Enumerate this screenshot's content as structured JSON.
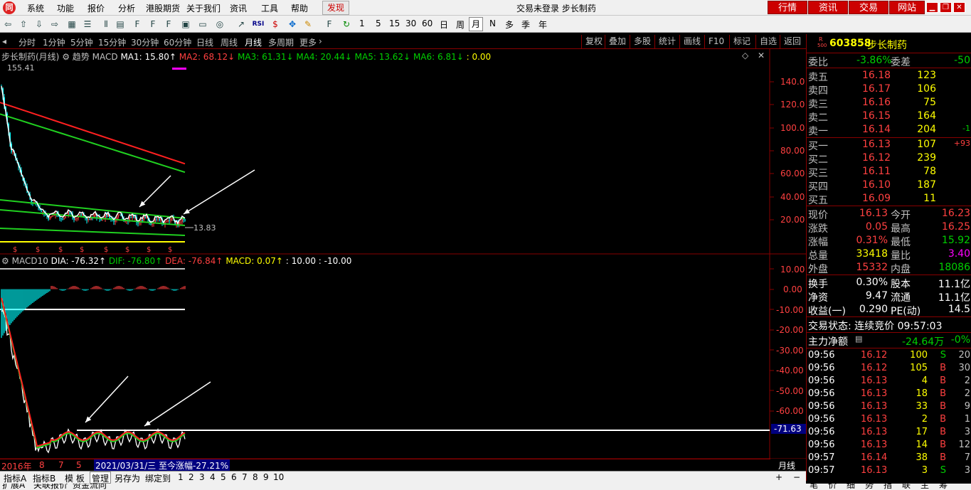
{
  "menubar": {
    "logo": "同",
    "items": [
      "系统",
      "功能",
      "报价",
      "分析",
      "港股期货",
      "关于我们",
      "资讯",
      "工具",
      "帮助"
    ],
    "active_item": "发现",
    "title": "交易未登录 步长制药",
    "right_tabs": [
      "行情",
      "资讯",
      "交易",
      "网站"
    ],
    "win_buttons": [
      "▁",
      "❐",
      "✕"
    ]
  },
  "toolbar": {
    "periods": [
      "1",
      "5",
      "15",
      "30",
      "60",
      "日",
      "周",
      "月",
      "N",
      "多",
      "季",
      "年"
    ],
    "selected_period": "月"
  },
  "periodbar": {
    "items": [
      "分时",
      "1分钟",
      "5分钟",
      "15分钟",
      "30分钟",
      "60分钟",
      "日线",
      "周线",
      "月线",
      "多周期",
      "更多"
    ],
    "selected": "月线",
    "more_arrow": "›",
    "right_items": [
      "复权",
      "叠加",
      "多股",
      "统计",
      "画线",
      "F10",
      "标记",
      "自选",
      "返回"
    ]
  },
  "main_legend": {
    "name": "步长制药(月线)",
    "mode": "趋势",
    "indicator": "MACD",
    "ma1": "MA1: 15.80↑",
    "ma2": "MA2: 68.12↓",
    "ma3": "MA3: 61.31↓",
    "ma4": "MA4: 20.44↓",
    "ma5": "MA5: 13.62↓",
    "ma6": "MA6: 6.81↓",
    "extra": ": 0.00",
    "high_label": "155.41",
    "last_label": "13.83"
  },
  "macd_legend": {
    "name": "MACD10",
    "dia": "DIA: -76.32↑",
    "dif": "DIF: -76.80↑",
    "dea": "DEA: -76.84↑",
    "macd": "MACD: 0.07↑",
    "p1": ": 10.00",
    "p2": ": -10.00"
  },
  "price_axis": [
    "140.0",
    "120.0",
    "100.0",
    "80.00",
    "60.00",
    "40.00",
    "20.00"
  ],
  "macd_axis": [
    "10.00",
    "0.00",
    "-10.00",
    "-20.00",
    "-30.00",
    "-40.00",
    "-50.00",
    "-60.00"
  ],
  "macd_highlight": "-71.63",
  "datebar": {
    "labels": [
      "2016年",
      "8",
      "7",
      "5"
    ],
    "info": "2021/03/31/三 至今涨幅-27.21%"
  },
  "period_label": "月线",
  "bottombar": {
    "items": [
      "指标A",
      "指标B",
      "模 板",
      "管理",
      "另存为",
      "绑定到",
      "1",
      "2",
      "3",
      "4",
      "5",
      "6",
      "7",
      "8",
      "9",
      "10"
    ],
    "selected": "管理"
  },
  "statusbar": {
    "items": [
      "扩展A",
      "关联报价",
      "资金流向"
    ],
    "right": [
      "笔",
      "价",
      "细",
      "势",
      "指",
      "联",
      "主",
      "筹"
    ]
  },
  "quote": {
    "badge_top": "R",
    "badge_bottom": "500",
    "code": "603858",
    "name": "步长制药",
    "weibi_label": "委比",
    "weibi": "-3.86%",
    "weicha_label": "委差",
    "weicha": "-50",
    "asks": [
      {
        "label": "卖五",
        "price": "16.18",
        "vol": "123",
        "chg": ""
      },
      {
        "label": "卖四",
        "price": "16.17",
        "vol": "106",
        "chg": ""
      },
      {
        "label": "卖三",
        "price": "16.16",
        "vol": "75",
        "chg": ""
      },
      {
        "label": "卖二",
        "price": "16.15",
        "vol": "164",
        "chg": ""
      },
      {
        "label": "卖一",
        "price": "16.14",
        "vol": "204",
        "chg": "-1"
      }
    ],
    "bids": [
      {
        "label": "买一",
        "price": "16.13",
        "vol": "107",
        "chg": "+93"
      },
      {
        "label": "买二",
        "price": "16.12",
        "vol": "239",
        "chg": ""
      },
      {
        "label": "买三",
        "price": "16.11",
        "vol": "78",
        "chg": ""
      },
      {
        "label": "买四",
        "price": "16.10",
        "vol": "187",
        "chg": ""
      },
      {
        "label": "买五",
        "price": "16.09",
        "vol": "11",
        "chg": ""
      }
    ],
    "stats": [
      {
        "l1": "现价",
        "v1": "16.13",
        "c1": "red",
        "l2": "今开",
        "v2": "16.23",
        "c2": "red"
      },
      {
        "l1": "涨跌",
        "v1": "0.05",
        "c1": "red",
        "l2": "最高",
        "v2": "16.25",
        "c2": "red"
      },
      {
        "l1": "涨幅",
        "v1": "0.31%",
        "c1": "red",
        "l2": "最低",
        "v2": "15.92",
        "c2": "green"
      },
      {
        "l1": "总量",
        "v1": "33418",
        "c1": "yellow",
        "l2": "量比",
        "v2": "3.40",
        "c2": "magenta"
      },
      {
        "l1": "外盘",
        "v1": "15332",
        "c1": "red",
        "l2": "内盘",
        "v2": "18086",
        "c2": "green"
      }
    ],
    "stats2": [
      {
        "l1": "换手",
        "v1": "0.30%",
        "l2": "股本",
        "v2": "11.1亿"
      },
      {
        "l1": "净资",
        "v1": "9.47",
        "l2": "流通",
        "v2": "11.1亿"
      },
      {
        "l1": "收益(一)",
        "v1": "0.290",
        "l2": "PE(动)",
        "v2": "14.5"
      }
    ],
    "trade_status": "交易状态: 连续竞价 09:57:03",
    "main_net_label": "主力净额",
    "main_net": "-24.64万",
    "main_net_pct": "-0%",
    "ticks": [
      {
        "t": "09:56",
        "p": "16.12",
        "pc": "red",
        "v": "100",
        "d": "S",
        "n": "20"
      },
      {
        "t": "09:56",
        "p": "16.12",
        "pc": "red",
        "v": "105",
        "d": "B",
        "n": "30"
      },
      {
        "t": "09:56",
        "p": "16.13",
        "pc": "red",
        "v": "4",
        "d": "B",
        "n": "2"
      },
      {
        "t": "09:56",
        "p": "16.13",
        "pc": "red",
        "v": "18",
        "d": "B",
        "n": "2"
      },
      {
        "t": "09:56",
        "p": "16.13",
        "pc": "red",
        "v": "33",
        "d": "B",
        "n": "9"
      },
      {
        "t": "09:56",
        "p": "16.13",
        "pc": "red",
        "v": "2",
        "d": "B",
        "n": "1"
      },
      {
        "t": "09:56",
        "p": "16.13",
        "pc": "red",
        "v": "17",
        "d": "B",
        "n": "3"
      },
      {
        "t": "09:56",
        "p": "16.13",
        "pc": "red",
        "v": "14",
        "d": "B",
        "n": "12"
      },
      {
        "t": "09:57",
        "p": "16.14",
        "pc": "red",
        "v": "38",
        "d": "B",
        "n": "7"
      },
      {
        "t": "09:57",
        "p": "16.13",
        "pc": "red",
        "v": "3",
        "d": "S",
        "n": "3"
      }
    ]
  },
  "colors": {
    "up": "#ff4040",
    "down": "#00d000",
    "accent": "#c00000"
  }
}
